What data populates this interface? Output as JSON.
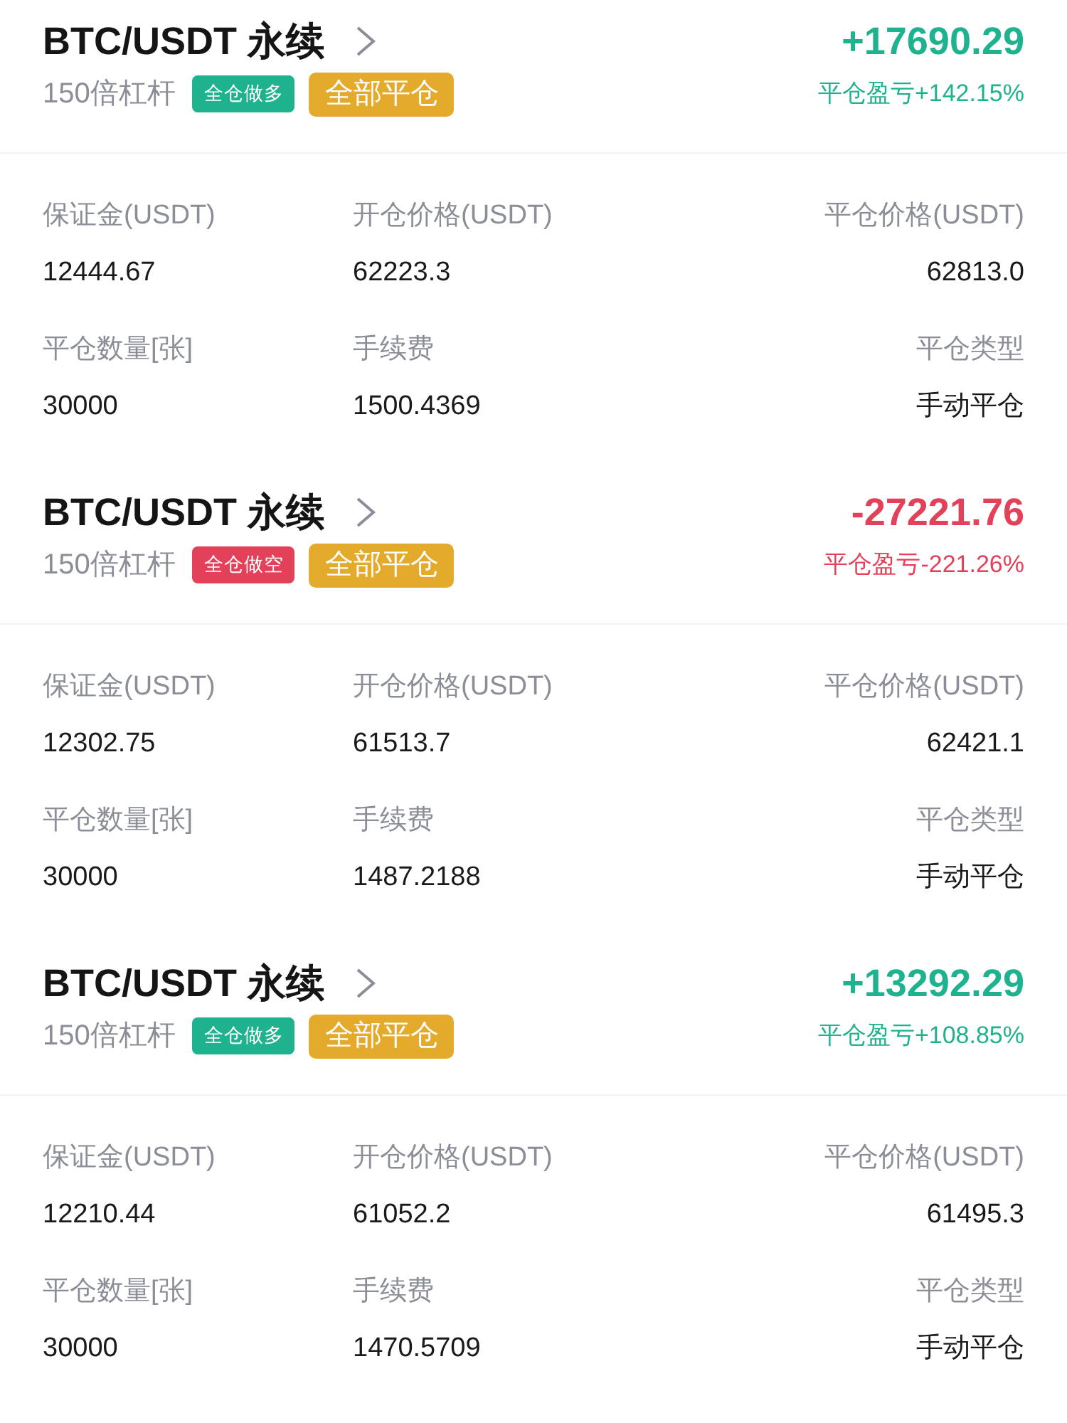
{
  "records": [
    {
      "pair": "BTC/USDT 永续",
      "leverage": "150倍杠杆",
      "side": {
        "label": "全仓做多",
        "color": "#1fb28f"
      },
      "action": "全部平仓",
      "pnl": {
        "amount": "+17690.29",
        "ratio": "平仓盈亏+142.15%",
        "color": "#1fb28f"
      },
      "fields": [
        {
          "label": "保证金(USDT)",
          "value": "12444.67"
        },
        {
          "label": "开仓价格(USDT)",
          "value": "62223.3"
        },
        {
          "label": "平仓价格(USDT)",
          "value": "62813.0"
        },
        {
          "label": "平仓数量[张]",
          "value": "30000"
        },
        {
          "label": "手续费",
          "value": "1500.4369"
        },
        {
          "label": "平仓类型",
          "value": "手动平仓"
        }
      ]
    },
    {
      "pair": "BTC/USDT 永续",
      "leverage": "150倍杠杆",
      "side": {
        "label": "全仓做空",
        "color": "#e3405a"
      },
      "action": "全部平仓",
      "pnl": {
        "amount": "-27221.76",
        "ratio": "平仓盈亏-221.26%",
        "color": "#e3405a"
      },
      "fields": [
        {
          "label": "保证金(USDT)",
          "value": "12302.75"
        },
        {
          "label": "开仓价格(USDT)",
          "value": "61513.7"
        },
        {
          "label": "平仓价格(USDT)",
          "value": "62421.1"
        },
        {
          "label": "平仓数量[张]",
          "value": "30000"
        },
        {
          "label": "手续费",
          "value": "1487.2188"
        },
        {
          "label": "平仓类型",
          "value": "手动平仓"
        }
      ]
    },
    {
      "pair": "BTC/USDT 永续",
      "leverage": "150倍杠杆",
      "side": {
        "label": "全仓做多",
        "color": "#1fb28f"
      },
      "action": "全部平仓",
      "pnl": {
        "amount": "+13292.29",
        "ratio": "平仓盈亏+108.85%",
        "color": "#1fb28f"
      },
      "fields": [
        {
          "label": "保证金(USDT)",
          "value": "12210.44"
        },
        {
          "label": "开仓价格(USDT)",
          "value": "61052.2"
        },
        {
          "label": "平仓价格(USDT)",
          "value": "61495.3"
        },
        {
          "label": "平仓数量[张]",
          "value": "30000"
        },
        {
          "label": "手续费",
          "value": "1470.5709"
        },
        {
          "label": "平仓类型",
          "value": "手动平仓"
        }
      ]
    }
  ]
}
